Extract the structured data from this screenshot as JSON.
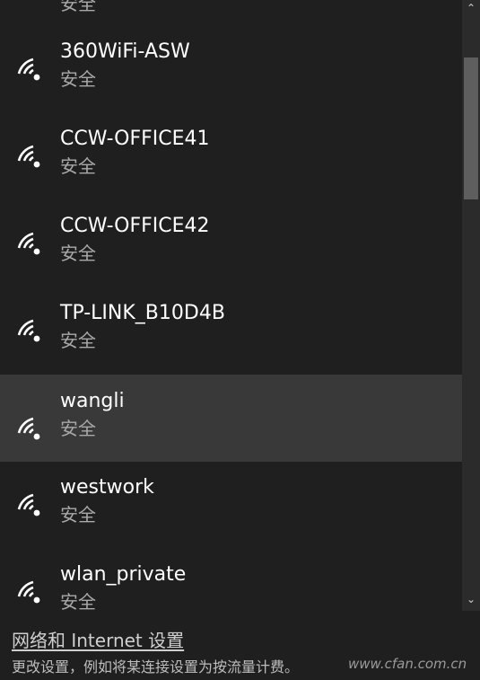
{
  "partial_top_status": "安全",
  "networks": [
    {
      "name": "360WiFi-ASW",
      "status": "安全",
      "selected": false
    },
    {
      "name": "CCW-OFFICE41",
      "status": "安全",
      "selected": false
    },
    {
      "name": "CCW-OFFICE42",
      "status": "安全",
      "selected": false
    },
    {
      "name": "TP-LINK_B10D4B",
      "status": "安全",
      "selected": false
    },
    {
      "name": "wangli",
      "status": "安全",
      "selected": true
    },
    {
      "name": "westwork",
      "status": "安全",
      "selected": false
    },
    {
      "name": "wlan_private",
      "status": "安全",
      "selected": false
    }
  ],
  "icons": {
    "network": "wifi-signal-icon",
    "scroll_up": "chevron-up-icon",
    "scroll_down": "chevron-down-icon",
    "scroll_up_glyph": "⌃",
    "scroll_down_glyph": "⌄"
  },
  "footer": {
    "settings_link": "网络和 Internet 设置",
    "hint": "更改设置，例如将某连接设置为按流量计费。",
    "watermark": "www.cfan.com.cn"
  },
  "colors": {
    "background": "#1f1f1f",
    "selected_row": "#393939",
    "status_text": "#a9a9a9",
    "scroll_thumb": "#5e5e5e"
  }
}
